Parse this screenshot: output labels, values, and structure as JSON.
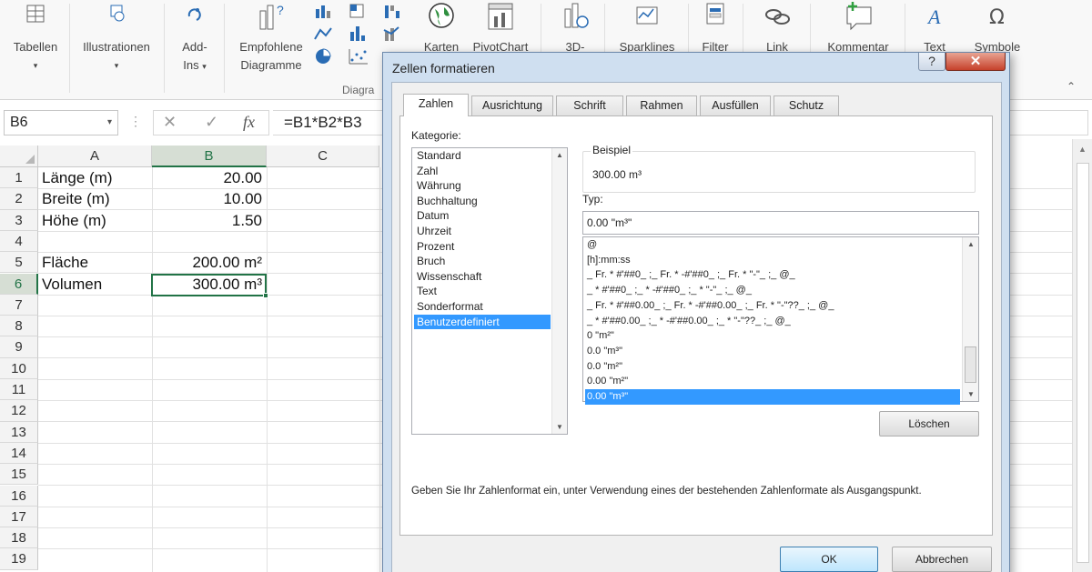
{
  "ribbon": {
    "tabellen": "Tabellen",
    "illustrationen": "Illustrationen",
    "addins_1": "Add-",
    "addins_2": "Ins",
    "empfohlene_1": "Empfohlene",
    "empfohlene_2": "Diagramme",
    "karten": "Karten",
    "pivotchart": "PivotChart",
    "threed": "3D-",
    "sparklines": "Sparklines",
    "filter": "Filter",
    "link": "Link",
    "kommentar": "Kommentar",
    "text": "Text",
    "symbole": "Symbole",
    "group_diagramme": "Diagra"
  },
  "formula_bar": {
    "name_box": "B6",
    "fx": "fx",
    "formula": "=B1*B2*B3"
  },
  "sheet": {
    "columns": [
      "A",
      "B",
      "C"
    ],
    "rows": [
      "1",
      "2",
      "3",
      "4",
      "5",
      "6",
      "7",
      "8",
      "9",
      "10",
      "11",
      "12",
      "13",
      "14",
      "15",
      "16",
      "17",
      "18",
      "19"
    ],
    "cells": {
      "a1": "Länge (m)",
      "b1": "20.00",
      "a2": "Breite (m)",
      "b2": "10.00",
      "a3": "Höhe (m)",
      "b3": "1.50",
      "a5": "Fläche",
      "b5": "200.00 m²",
      "a6": "Volumen",
      "b6": "300.00 m³"
    }
  },
  "dialog": {
    "title": "Zellen formatieren",
    "help": "?",
    "close": "✕",
    "tabs": [
      "Zahlen",
      "Ausrichtung",
      "Schrift",
      "Rahmen",
      "Ausfüllen",
      "Schutz"
    ],
    "kategorie_label": "Kategorie:",
    "categories": [
      "Standard",
      "Zahl",
      "Währung",
      "Buchhaltung",
      "Datum",
      "Uhrzeit",
      "Prozent",
      "Bruch",
      "Wissenschaft",
      "Text",
      "Sonderformat",
      "Benutzerdefiniert"
    ],
    "selected_category": "Benutzerdefiniert",
    "beispiel_label": "Beispiel",
    "beispiel_value": "300.00 m³",
    "typ_label": "Typ:",
    "typ_value": "0.00 \"m³\"",
    "formats": [
      "@",
      "[h]:mm:ss",
      "_ Fr. * #'##0_ ;_ Fr. * -#'##0_ ;_ Fr. * \"-\"_ ;_ @_",
      "_ * #'##0_ ;_ * -#'##0_ ;_ * \"-\"_ ;_ @_",
      "_ Fr. * #'##0.00_ ;_ Fr. * -#'##0.00_ ;_ Fr. * \"-\"??_ ;_ @_",
      "_ * #'##0.00_ ;_ * -#'##0.00_ ;_ * \"-\"??_ ;_ @_",
      "0 \"m²\"",
      "0.0 \"m³\"",
      "0.0 \"m²\"",
      "0.00 \"m²\"",
      "0.00 \"m³\""
    ],
    "loeschen": "Löschen",
    "hint": "Geben Sie Ihr Zahlenformat ein, unter Verwendung eines der bestehenden Zahlenformate als Ausgangspunkt.",
    "ok": "OK",
    "abbrechen": "Abbrechen"
  },
  "colors": {
    "excel_green": "#217346",
    "selection_blue": "#3399ff",
    "dialog_frame": "#cfdff0"
  }
}
